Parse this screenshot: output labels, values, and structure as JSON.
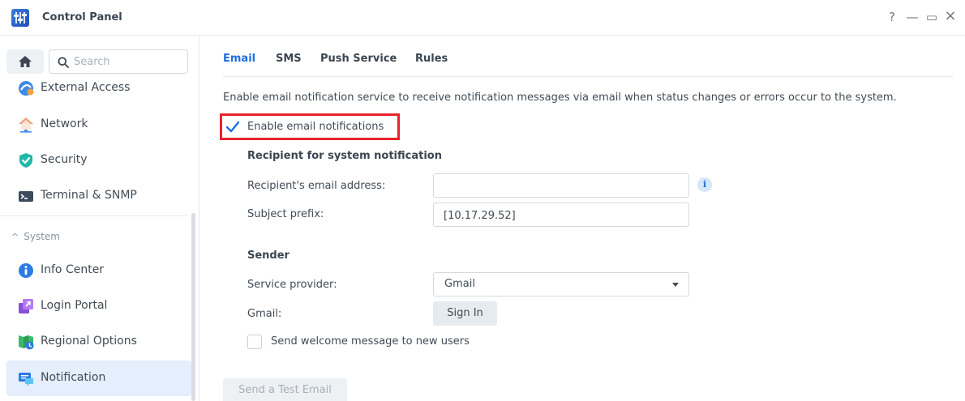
{
  "window": {
    "title": "Control Panel",
    "controls": {
      "help": "?",
      "minimize": "—",
      "maximize": "▭",
      "close": "×"
    }
  },
  "sidebar": {
    "search_placeholder": "Search",
    "items": [
      {
        "label": "External Access",
        "icon": "external-access-icon"
      },
      {
        "label": "Network",
        "icon": "network-icon"
      },
      {
        "label": "Security",
        "icon": "shield-check-icon"
      },
      {
        "label": "Terminal & SNMP",
        "icon": "terminal-icon"
      }
    ],
    "section": {
      "label": "System",
      "chevron": "^"
    },
    "system_items": [
      {
        "label": "Info Center",
        "icon": "info-icon"
      },
      {
        "label": "Login Portal",
        "icon": "login-portal-icon"
      },
      {
        "label": "Regional Options",
        "icon": "regional-options-icon"
      },
      {
        "label": "Notification",
        "icon": "notification-icon",
        "active": true
      }
    ]
  },
  "tabs": [
    {
      "label": "Email",
      "active": true
    },
    {
      "label": "SMS",
      "active": false
    },
    {
      "label": "Push Service",
      "active": false
    },
    {
      "label": "Rules",
      "active": false
    }
  ],
  "email": {
    "description": "Enable email notification service to receive notification messages via email when status changes or errors occur to the system.",
    "enable_label": "Enable email notifications",
    "enable_checked": true,
    "recipient_heading": "Recipient for system notification",
    "recipient_label": "Recipient's email address:",
    "recipient_value": "",
    "info_glyph": "i",
    "subject_label": "Subject prefix:",
    "subject_value": "[10.17.29.52]",
    "sender_heading": "Sender",
    "provider_label": "Service provider:",
    "provider_value": "Gmail",
    "gmail_label": "Gmail:",
    "sign_in_label": "Sign In",
    "welcome_label": "Send welcome message to new users",
    "welcome_checked": false,
    "test_email_label": "Send a Test Email"
  },
  "colors": {
    "accent": "#1f6fe0",
    "highlight_border": "#e8222d",
    "active_nav_bg": "#e4eefc"
  }
}
